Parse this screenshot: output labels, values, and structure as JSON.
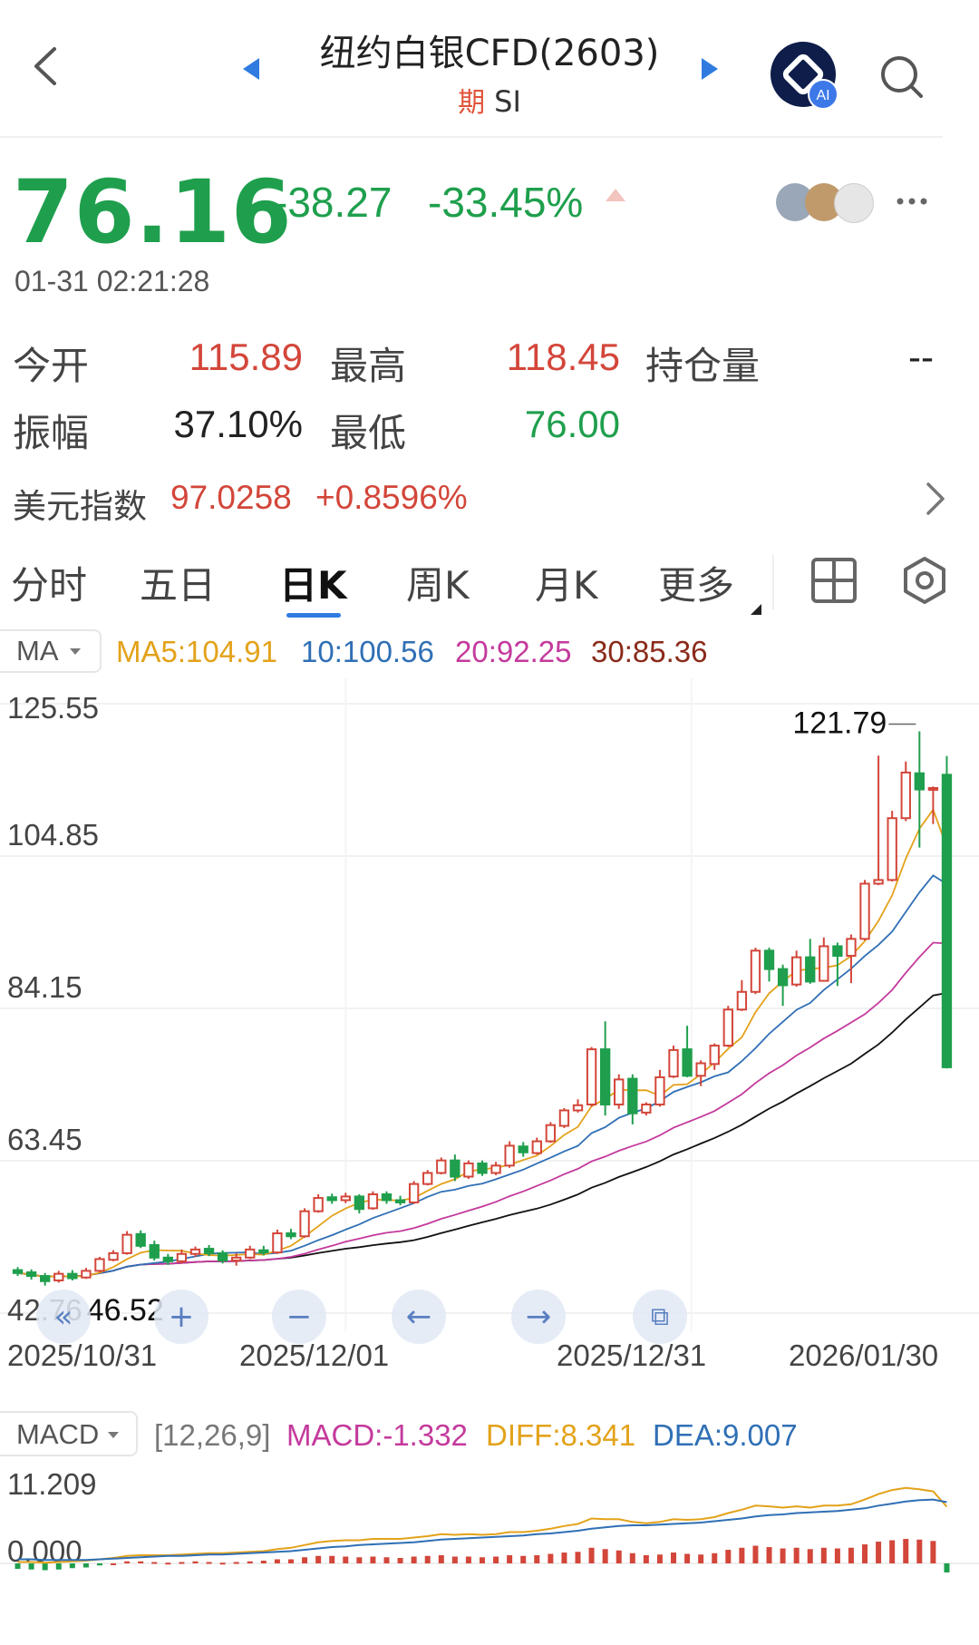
{
  "header": {
    "title": "纽约白银CFD(2603)",
    "tag": "期",
    "symbol": "SI"
  },
  "quote": {
    "price": "76.16",
    "change": "-38.27",
    "change_pct": "-33.45%",
    "timestamp": "01-31 02:21:28"
  },
  "stats": {
    "open_label": "今开",
    "open": "115.89",
    "high_label": "最高",
    "high": "118.45",
    "oi_label": "持仓量",
    "oi": "--",
    "amp_label": "振幅",
    "amp": "37.10%",
    "low_label": "最低",
    "low": "76.00"
  },
  "usd_index": {
    "label": "美元指数",
    "value": "97.0258",
    "change": "+0.8596%"
  },
  "tabs": [
    "分时",
    "五日",
    "日K",
    "周K",
    "月K",
    "更多"
  ],
  "active_tab": "日K",
  "ma": {
    "selector": "MA",
    "ma5": "MA5:104.91",
    "ma10": "10:100.56",
    "ma20": "20:92.25",
    "ma30": "30:85.36"
  },
  "colors": {
    "up": "#d3463a",
    "down": "#1f9f4d",
    "ma5": "#e3a21a",
    "ma10": "#2f6fb5",
    "ma20": "#c43a9c",
    "ma30": "#111111",
    "accent": "#2f7be0"
  },
  "chart_data": {
    "type": "candlestick",
    "y_ticks": [
      "125.55",
      "104.85",
      "84.15",
      "63.45",
      "42.76"
    ],
    "ylim": [
      42.76,
      125.55
    ],
    "max_label": "121.79",
    "min_label": "46.52",
    "x_ticks": [
      "2025/10/31",
      "2025/12/01",
      "2025/12/31",
      "2026/01/30"
    ],
    "candles": [
      {
        "o": 48.6,
        "c": 48.2,
        "h": 49.0,
        "l": 47.8
      },
      {
        "o": 48.3,
        "c": 47.8,
        "h": 48.7,
        "l": 47.3
      },
      {
        "o": 47.8,
        "c": 47.1,
        "h": 48.2,
        "l": 46.5
      },
      {
        "o": 47.2,
        "c": 48.1,
        "h": 48.5,
        "l": 46.9
      },
      {
        "o": 48.1,
        "c": 47.5,
        "h": 48.6,
        "l": 47.2
      },
      {
        "o": 47.6,
        "c": 48.5,
        "h": 48.9,
        "l": 47.4
      },
      {
        "o": 48.5,
        "c": 50.1,
        "h": 50.4,
        "l": 48.3
      },
      {
        "o": 50.0,
        "c": 50.9,
        "h": 51.3,
        "l": 49.8
      },
      {
        "o": 50.9,
        "c": 53.4,
        "h": 53.9,
        "l": 50.7
      },
      {
        "o": 53.5,
        "c": 51.9,
        "h": 54.0,
        "l": 51.6
      },
      {
        "o": 52.0,
        "c": 50.3,
        "h": 52.6,
        "l": 49.9
      },
      {
        "o": 50.3,
        "c": 49.8,
        "h": 50.8,
        "l": 49.3
      },
      {
        "o": 49.8,
        "c": 50.8,
        "h": 51.4,
        "l": 49.5
      },
      {
        "o": 50.8,
        "c": 51.4,
        "h": 51.8,
        "l": 50.4
      },
      {
        "o": 51.5,
        "c": 50.9,
        "h": 52.0,
        "l": 50.5
      },
      {
        "o": 50.9,
        "c": 49.9,
        "h": 51.3,
        "l": 49.5
      },
      {
        "o": 49.9,
        "c": 50.3,
        "h": 50.9,
        "l": 49.2
      },
      {
        "o": 50.3,
        "c": 51.4,
        "h": 51.9,
        "l": 50.1
      },
      {
        "o": 51.3,
        "c": 51.0,
        "h": 51.9,
        "l": 50.6
      },
      {
        "o": 51.0,
        "c": 53.6,
        "h": 54.1,
        "l": 50.8
      },
      {
        "o": 53.6,
        "c": 53.2,
        "h": 54.2,
        "l": 52.8
      },
      {
        "o": 53.2,
        "c": 56.6,
        "h": 57.0,
        "l": 53.0
      },
      {
        "o": 56.6,
        "c": 58.4,
        "h": 58.9,
        "l": 56.4
      },
      {
        "o": 58.5,
        "c": 58.1,
        "h": 59.0,
        "l": 57.6
      },
      {
        "o": 58.1,
        "c": 58.6,
        "h": 59.1,
        "l": 57.7
      },
      {
        "o": 58.6,
        "c": 56.9,
        "h": 58.9,
        "l": 56.3
      },
      {
        "o": 57.0,
        "c": 58.9,
        "h": 59.3,
        "l": 56.8
      },
      {
        "o": 58.9,
        "c": 58.1,
        "h": 59.3,
        "l": 57.6
      },
      {
        "o": 58.1,
        "c": 57.8,
        "h": 58.7,
        "l": 57.4
      },
      {
        "o": 57.8,
        "c": 60.3,
        "h": 60.7,
        "l": 57.6
      },
      {
        "o": 60.3,
        "c": 61.8,
        "h": 62.2,
        "l": 60.1
      },
      {
        "o": 61.8,
        "c": 63.5,
        "h": 63.9,
        "l": 61.6
      },
      {
        "o": 63.5,
        "c": 61.3,
        "h": 64.3,
        "l": 60.7
      },
      {
        "o": 61.3,
        "c": 63.1,
        "h": 63.5,
        "l": 61.0
      },
      {
        "o": 63.1,
        "c": 61.8,
        "h": 63.5,
        "l": 61.4
      },
      {
        "o": 61.8,
        "c": 62.8,
        "h": 63.3,
        "l": 61.5
      },
      {
        "o": 62.8,
        "c": 65.5,
        "h": 66.1,
        "l": 62.5
      },
      {
        "o": 65.4,
        "c": 64.6,
        "h": 66.0,
        "l": 64.0
      },
      {
        "o": 64.5,
        "c": 66.1,
        "h": 66.6,
        "l": 64.3
      },
      {
        "o": 66.1,
        "c": 68.3,
        "h": 68.7,
        "l": 65.9
      },
      {
        "o": 68.2,
        "c": 70.3,
        "h": 70.6,
        "l": 67.9
      },
      {
        "o": 70.3,
        "c": 71.0,
        "h": 71.8,
        "l": 70.0
      },
      {
        "o": 71.1,
        "c": 78.6,
        "h": 78.9,
        "l": 70.8
      },
      {
        "o": 78.6,
        "c": 71.1,
        "h": 82.4,
        "l": 69.6
      },
      {
        "o": 71.1,
        "c": 74.5,
        "h": 75.2,
        "l": 70.5
      },
      {
        "o": 74.6,
        "c": 69.9,
        "h": 75.2,
        "l": 68.4
      },
      {
        "o": 70.0,
        "c": 71.1,
        "h": 71.4,
        "l": 69.6
      },
      {
        "o": 71.1,
        "c": 74.8,
        "h": 75.8,
        "l": 70.8
      },
      {
        "o": 74.9,
        "c": 78.5,
        "h": 79.1,
        "l": 74.7
      },
      {
        "o": 78.6,
        "c": 75.0,
        "h": 81.8,
        "l": 74.8
      },
      {
        "o": 75.0,
        "c": 76.7,
        "h": 77.1,
        "l": 73.6
      },
      {
        "o": 76.6,
        "c": 79.1,
        "h": 79.4,
        "l": 75.8
      },
      {
        "o": 79.1,
        "c": 84.0,
        "h": 84.5,
        "l": 78.9
      },
      {
        "o": 84.0,
        "c": 86.4,
        "h": 88.0,
        "l": 83.8
      },
      {
        "o": 86.4,
        "c": 92.0,
        "h": 92.4,
        "l": 86.1
      },
      {
        "o": 92.0,
        "c": 89.5,
        "h": 92.4,
        "l": 87.8
      },
      {
        "o": 89.5,
        "c": 87.3,
        "h": 90.1,
        "l": 84.5
      },
      {
        "o": 87.4,
        "c": 91.1,
        "h": 92.0,
        "l": 87.1
      },
      {
        "o": 91.1,
        "c": 87.8,
        "h": 93.6,
        "l": 87.5
      },
      {
        "o": 87.9,
        "c": 92.6,
        "h": 93.8,
        "l": 87.8
      },
      {
        "o": 92.6,
        "c": 91.3,
        "h": 93.1,
        "l": 87.2
      },
      {
        "o": 91.3,
        "c": 93.6,
        "h": 94.2,
        "l": 87.6
      },
      {
        "o": 93.6,
        "c": 101.1,
        "h": 101.6,
        "l": 93.4
      },
      {
        "o": 101.1,
        "c": 101.6,
        "h": 118.5,
        "l": 100.9
      },
      {
        "o": 101.6,
        "c": 110.0,
        "h": 111.0,
        "l": 101.4
      },
      {
        "o": 110.0,
        "c": 116.2,
        "h": 117.7,
        "l": 109.6
      },
      {
        "o": 116.1,
        "c": 113.9,
        "h": 121.8,
        "l": 106.0
      },
      {
        "o": 114.0,
        "c": 114.1,
        "h": 114.3,
        "l": 109.2
      },
      {
        "o": 115.9,
        "c": 76.16,
        "h": 118.45,
        "l": 76.0
      }
    ],
    "ma_labels": [
      "MA5",
      "10",
      "20",
      "30"
    ],
    "macd": {
      "params": "[12,26,9]",
      "macd_label": "MACD:-1.332",
      "diff_label": "DIFF:8.341",
      "dea_label": "DEA:9.007",
      "y_ticks": [
        "11.209",
        "0.000"
      ],
      "ylim": [
        -2.0,
        11.209
      ],
      "histogram": [
        -0.8,
        -0.9,
        -1.0,
        -0.9,
        -0.7,
        -0.6,
        -0.3,
        0.0,
        0.3,
        0.3,
        0.2,
        0.1,
        0.2,
        0.3,
        0.2,
        0.1,
        0.2,
        0.3,
        0.4,
        0.6,
        0.6,
        0.9,
        1.1,
        1.1,
        1.0,
        0.9,
        1.0,
        0.9,
        0.8,
        1.0,
        1.1,
        1.2,
        1.0,
        1.0,
        0.9,
        1.0,
        1.2,
        1.1,
        1.2,
        1.4,
        1.6,
        1.7,
        2.3,
        2.1,
        1.9,
        1.5,
        1.2,
        1.3,
        1.6,
        1.4,
        1.3,
        1.5,
        2.0,
        2.3,
        2.6,
        2.4,
        2.2,
        2.3,
        2.1,
        2.3,
        2.2,
        2.3,
        2.8,
        3.2,
        3.4,
        3.6,
        3.5,
        3.3,
        -1.332
      ],
      "diff": [
        0.2,
        0.2,
        0.1,
        0.2,
        0.3,
        0.4,
        0.6,
        0.8,
        1.1,
        1.2,
        1.2,
        1.2,
        1.3,
        1.4,
        1.5,
        1.5,
        1.6,
        1.7,
        1.8,
        2.1,
        2.3,
        2.7,
        3.1,
        3.3,
        3.4,
        3.4,
        3.6,
        3.6,
        3.6,
        3.8,
        4.0,
        4.3,
        4.2,
        4.3,
        4.2,
        4.3,
        4.6,
        4.6,
        4.8,
        5.1,
        5.5,
        5.8,
        6.6,
        6.5,
        6.5,
        6.1,
        5.9,
        6.1,
        6.5,
        6.4,
        6.5,
        6.8,
        7.4,
        7.9,
        8.5,
        8.4,
        8.2,
        8.4,
        8.2,
        8.5,
        8.5,
        8.7,
        9.4,
        10.2,
        10.8,
        11.1,
        10.9,
        10.6,
        8.341
      ],
      "dea": [
        0.6,
        0.6,
        0.5,
        0.5,
        0.5,
        0.5,
        0.6,
        0.7,
        0.8,
        0.9,
        1.0,
        1.1,
        1.1,
        1.2,
        1.3,
        1.3,
        1.4,
        1.5,
        1.6,
        1.7,
        1.8,
        2.0,
        2.2,
        2.4,
        2.5,
        2.7,
        2.8,
        2.9,
        3.0,
        3.1,
        3.3,
        3.5,
        3.6,
        3.7,
        3.8,
        3.9,
        4.0,
        4.1,
        4.3,
        4.4,
        4.6,
        4.8,
        5.1,
        5.3,
        5.5,
        5.6,
        5.6,
        5.7,
        5.8,
        5.9,
        6.0,
        6.2,
        6.4,
        6.6,
        6.9,
        7.1,
        7.2,
        7.4,
        7.5,
        7.6,
        7.7,
        7.9,
        8.1,
        8.5,
        8.8,
        9.1,
        9.3,
        9.4,
        9.007
      ]
    }
  }
}
